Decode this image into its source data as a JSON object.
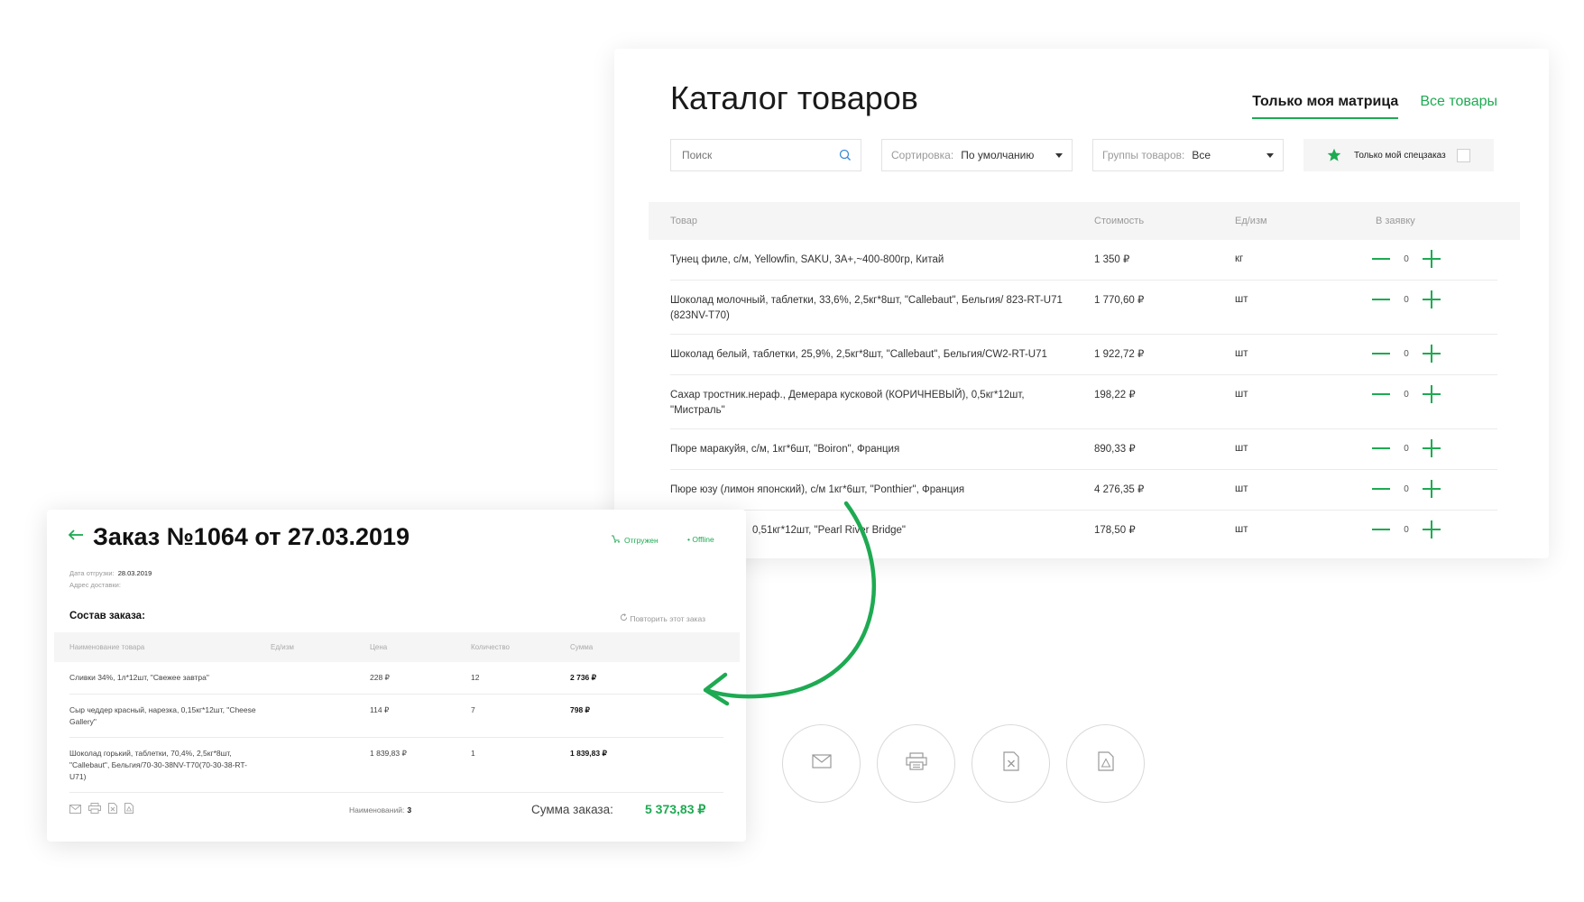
{
  "catalog": {
    "title": "Каталог товаров",
    "tab_my": "Только моя матрица",
    "tab_all": "Все товары",
    "search_placeholder": "Поиск",
    "sort_label": "Сортировка:",
    "sort_value": "По умолчанию",
    "group_label": "Группы товаров:",
    "group_value": "Все",
    "special_label": "Только мой спецзаказ",
    "columns": {
      "product": "Товар",
      "price": "Стоимость",
      "unit": "Ед/изм",
      "order": "В заявку"
    },
    "rows": [
      {
        "name": "Тунец филе, с/м, Yellowfin, SAKU, 3A+,~400-800гр, Китай",
        "price": "1 350 ₽",
        "unit": "кг",
        "qty": "0"
      },
      {
        "name": "Шоколад молочный, таблетки, 33,6%, 2,5кг*8шт, \"Callebaut\", Бельгия/ 823-RT-U71 (823NV-T70)",
        "price": "1 770,60 ₽",
        "unit": "шт",
        "qty": "0"
      },
      {
        "name": "Шоколад белый, таблетки, 25,9%, 2,5кг*8шт, \"Callebaut\", Бельгия/CW2-RT-U71",
        "price": "1 922,72 ₽",
        "unit": "шт",
        "qty": "0"
      },
      {
        "name": "Сахар тростник.нераф., Демерара кусковой (КОРИЧНЕВЫЙ), 0,5кг*12шт, \"Мистраль\"",
        "price": "198,22 ₽",
        "unit": "шт",
        "qty": "0"
      },
      {
        "name": "Пюре маракуйя, с/м, 1кг*6шт, \"Boiron\", Франция",
        "price": "890,33 ₽",
        "unit": "шт",
        "qty": "0"
      },
      {
        "name": "Пюре юзу (лимон японский), с/м 1кг*6шт, \"Ponthier\", Франция",
        "price": "4 276,35 ₽",
        "unit": "шт",
        "qty": "0"
      },
      {
        "name": "0,51кг*12шт, \"Pearl River Bridge\"",
        "price": "178,50 ₽",
        "unit": "шт",
        "qty": "0"
      }
    ]
  },
  "order": {
    "title": "Заказ №1064 от 27.03.2019",
    "status_shipped": "Отгружен",
    "status_offline": "• Offline",
    "ship_date_label": "Дата отгрузки:",
    "ship_date": "28.03.2019",
    "address_label": "Адрес доставки:",
    "composition_title": "Состав заказа:",
    "repeat_label": "Повторить этот заказ",
    "columns": {
      "name": "Наименование товара",
      "unit": "Ед/изм",
      "price": "Цена",
      "qty": "Количество",
      "sum": "Сумма"
    },
    "rows": [
      {
        "name": "Сливки 34%, 1л*12шт, \"Свежее завтра\"",
        "price": "228 ₽",
        "qty": "12",
        "sum": "2 736 ₽"
      },
      {
        "name": "Сыр чеддер красный, нарезка, 0,15кг*12шт, \"Cheese Gallery\"",
        "price": "114 ₽",
        "qty": "7",
        "sum": "798 ₽"
      },
      {
        "name": "Шоколад горький, таблетки, 70,4%, 2,5кг*8шт, \"Callebaut\", Бельгия/70-30-38NV-T70(70-30-38-RT-U71)",
        "price": "1 839,83 ₽",
        "qty": "1",
        "sum": "1 839,83 ₽"
      }
    ],
    "items_count_label": "Наименований:",
    "items_count": "3",
    "total_label": "Сумма заказа:",
    "total_value": "5 373,83 ₽"
  },
  "actions": [
    "mail-icon",
    "print-icon",
    "excel-icon",
    "pdf-icon"
  ],
  "colors": {
    "accent": "#1eaa52",
    "header_bg": "#f5f5f5"
  }
}
